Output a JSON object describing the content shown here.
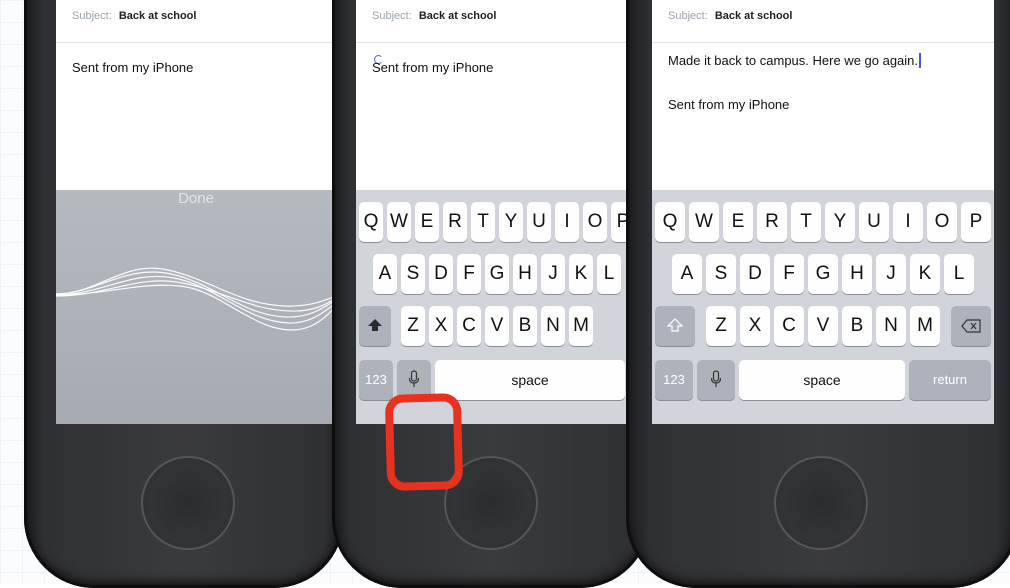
{
  "email": {
    "subject_label": "Subject:",
    "subject_value": "Back at school",
    "signature": "Sent from my iPhone",
    "dictated_text": "Made it back to campus. Here we go again."
  },
  "siri": {
    "done_label": "Done"
  },
  "keyboard": {
    "row1": [
      "Q",
      "W",
      "E",
      "R",
      "T",
      "Y",
      "U",
      "I",
      "O",
      "P"
    ],
    "row2": [
      "A",
      "S",
      "D",
      "F",
      "G",
      "H",
      "J",
      "K",
      "L"
    ],
    "row3": [
      "Z",
      "X",
      "C",
      "V",
      "B",
      "N",
      "M"
    ],
    "numbers_label": "123",
    "space_label": "space",
    "return_label": "return",
    "shift_icon": "shift-icon",
    "mic_icon": "microphone-icon",
    "delete_icon": "delete-backspace-icon"
  },
  "annotation": {
    "highlight_color": "#e8321f",
    "target": "microphone-key"
  }
}
